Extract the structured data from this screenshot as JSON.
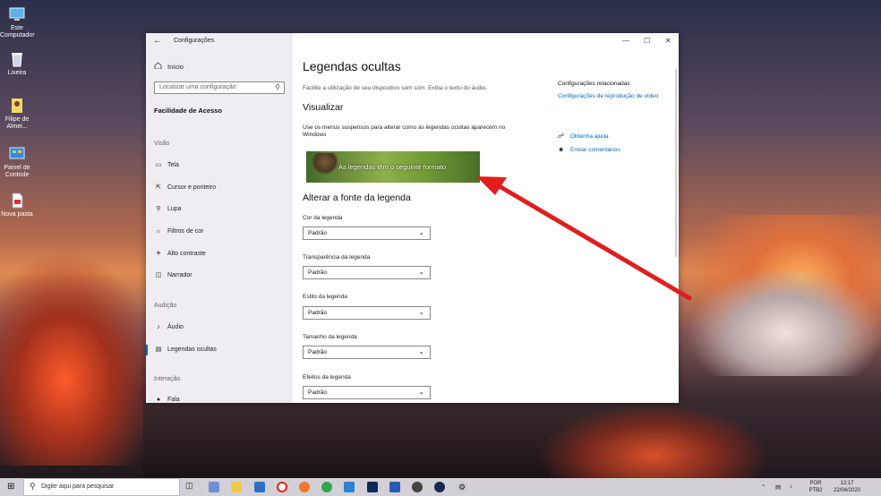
{
  "desktop": {
    "icons": [
      {
        "label": "Este Computador"
      },
      {
        "label": "Lixeira"
      },
      {
        "label": "Filipe de Almei..."
      },
      {
        "label": "Painel de Controle"
      },
      {
        "label": "Nova pasta"
      }
    ]
  },
  "window": {
    "app_title": "Configurações",
    "home_label": "Início",
    "search_placeholder": "Localizar uma configuração",
    "section_title": "Facilidade de Acesso",
    "groups": {
      "vision": "Visão",
      "audio": "Audição",
      "interaction": "Interação"
    },
    "nav": {
      "display": "Tela",
      "cursor": "Cursor e ponteiro",
      "magnifier": "Lupa",
      "color_filters": "Filtros de cor",
      "high_contrast": "Alto contraste",
      "narrator": "Narrador",
      "audio": "Áudio",
      "captions": "Legendas ocultas",
      "speech": "Fala"
    }
  },
  "main": {
    "title": "Legendas ocultas",
    "description": "Facilite a utilização de seu dispositivo sem som. Exiba o texto do áudio.",
    "preview_heading": "Visualizar",
    "preview_description": "Use os menus suspensos para alterar como as legendas ocultas aparecem no Windows",
    "preview_text": "As legendas têm o seguinte formato",
    "font_heading": "Alterar a fonte da legenda",
    "fields": [
      {
        "label": "Cor da legenda",
        "value": "Padrão"
      },
      {
        "label": "Transparência da legenda",
        "value": "Padrão"
      },
      {
        "label": "Estilo da legenda",
        "value": "Padrão"
      },
      {
        "label": "Tamanho da legenda",
        "value": "Padrão"
      },
      {
        "label": "Efeitos da legenda",
        "value": "Padrão"
      }
    ],
    "related_heading": "Configurações relacionadas",
    "related_link": "Configurações de reprodução de vídeo",
    "help_link": "Obtenha ajuda",
    "feedback_link": "Enviar comentários"
  },
  "taskbar": {
    "search_placeholder": "Digite aqui para pesquisar",
    "lang_top": "POR",
    "lang_bottom": "PTB2",
    "time": "12:17",
    "date": "22/04/2020"
  },
  "colors": {
    "accent": "#0067c0",
    "arrow": "#e01e1e"
  }
}
